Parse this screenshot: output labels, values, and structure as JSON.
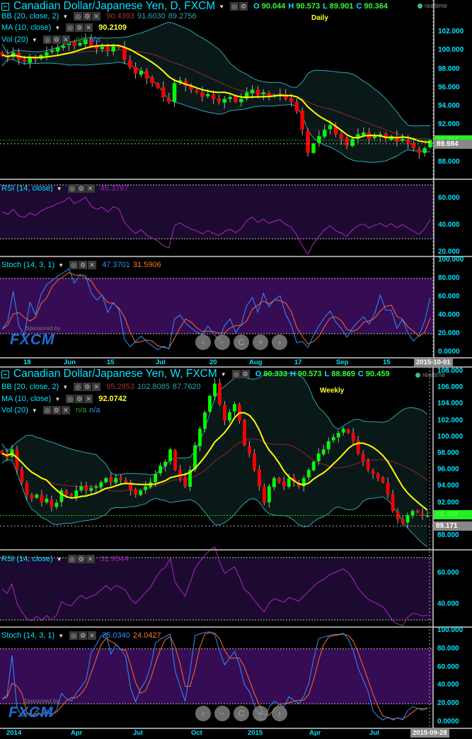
{
  "daily": {
    "title": "Canadian Dollar/Japanese Yen, D, FXCM",
    "ohlc": {
      "o_label": "O",
      "o": "90.044",
      "h_label": "H",
      "h": "90.573",
      "l_label": "L",
      "l": "89.901",
      "c_label": "C",
      "c": "90.364"
    },
    "realtime": "realtime",
    "timeframe": "Daily",
    "bb": {
      "label": "BB (20, close, 2)",
      "mid": "90.4393",
      "upper": "91.6030",
      "lower": "89.2756"
    },
    "ma": {
      "label": "MA (10, close)",
      "value": "90.2109"
    },
    "vol": {
      "label": "Vol (20)",
      "v1": "n/a",
      "v2": "n/a"
    },
    "rsi": {
      "label": "RSI (14, close)",
      "value": "45.3797"
    },
    "stoch": {
      "label": "Stoch (14, 3, 1)",
      "k": "47.3701",
      "d": "31.5906"
    },
    "price_axis": [
      "102.000",
      "100.000",
      "98.000",
      "96.000",
      "94.000",
      "92.000",
      "88.000"
    ],
    "last_price": "89.984",
    "current_price": "90.364",
    "rsi_axis": [
      "60.000",
      "40.000",
      "20.000"
    ],
    "stoch_axis": [
      "100.000",
      "80.000",
      "60.000",
      "40.000",
      "20.000",
      "0.0000"
    ],
    "x_axis": [
      "18",
      "Jun",
      "15",
      "Jul",
      "20",
      "Aug",
      "17",
      "Sep",
      "15"
    ],
    "date_badge": "2015-10-01"
  },
  "weekly": {
    "title": "Canadian Dollar/Japanese Yen, W, FXCM",
    "ohlc": {
      "o_label": "O",
      "o": "90.333",
      "h_label": "H",
      "h": "90.573",
      "l_label": "L",
      "l": "88.869",
      "c_label": "C",
      "c": "90.459"
    },
    "realtime": "realtime",
    "timeframe": "Weekly",
    "bb": {
      "label": "BB (20, close, 2)",
      "mid": "95.2853",
      "upper": "102.8085",
      "lower": "87.7620"
    },
    "ma": {
      "label": "MA (10, close)",
      "value": "92.0742"
    },
    "vol": {
      "label": "Vol (20)",
      "v1": "n/a",
      "v2": "n/a"
    },
    "rsi": {
      "label": "RSI (14, close)",
      "value": "31.9544"
    },
    "stoch": {
      "label": "Stoch (14, 3, 1)",
      "k": "25.0340",
      "d": "24.0427"
    },
    "price_axis": [
      "108.000",
      "106.000",
      "104.000",
      "102.000",
      "100.000",
      "98.000",
      "96.000",
      "94.000",
      "92.000",
      "88.000"
    ],
    "last_price": "89.171",
    "current_price": "90.459",
    "rsi_axis": [
      "60.000",
      "40.000"
    ],
    "stoch_axis": [
      "100.000",
      "80.000",
      "60.000",
      "40.000",
      "20.000",
      "0.0000"
    ],
    "x_axis": [
      "2014",
      "Apr",
      "Jul",
      "Oct",
      "2015",
      "Apr",
      "Jul"
    ],
    "date_badge": "2015-09-28"
  },
  "sponsor": {
    "text": "Sponsored by",
    "brand": "FXCM"
  },
  "nav": {
    "prev": "‹",
    "zoom_out": "−",
    "reset": "C",
    "zoom_in": "+",
    "next": "›"
  },
  "controls": {
    "visibility": "◎",
    "settings": "⚙",
    "remove": "✕",
    "dropdown": "▼"
  },
  "colors": {
    "up": "#00ff00",
    "down": "#ff0000",
    "ma": "#ffff00",
    "bb_band": "#2aa7b0",
    "bb_mid": "#8b2a2a",
    "rsi": "#b026c8",
    "stoch_k": "#2f8fff",
    "stoch_d": "#ff6a2a"
  },
  "chart_data": [
    {
      "type": "candlestick",
      "name": "CAD/JPY Daily",
      "ylim": [
        87,
        103
      ],
      "close": [
        99.5,
        99.2,
        99.8,
        99.0,
        98.8,
        99.3,
        99.0,
        99.5,
        99.8,
        100.0,
        100.3,
        100.5,
        101.0,
        100.5,
        100.8,
        101.2,
        100.5,
        100.2,
        100.4,
        100.0,
        100.5,
        100.3,
        99.0,
        98.2,
        97.5,
        97.8,
        97.0,
        96.5,
        96.0,
        95.0,
        94.5,
        96.5,
        96.8,
        96.2,
        95.8,
        95.5,
        95.0,
        95.3,
        94.8,
        94.5,
        94.8,
        95.0,
        94.5,
        94.8,
        95.5,
        95.8,
        95.2,
        95.5,
        95.0,
        95.2,
        95.3,
        94.8,
        94.5,
        93.5,
        91.5,
        89.0,
        90.0,
        90.8,
        91.5,
        92.0,
        91.0,
        90.5,
        89.8,
        90.5,
        91.0,
        91.2,
        90.5,
        90.8,
        91.0,
        90.5,
        90.8,
        90.2,
        90.5,
        90.0,
        89.5,
        89.0,
        89.5,
        90.364
      ]
    },
    {
      "type": "candlestick",
      "name": "CAD/JPY Weekly",
      "ylim": [
        87,
        108
      ],
      "close": [
        98,
        97.5,
        98.5,
        96,
        94.5,
        93,
        92.5,
        93,
        92,
        92.5,
        91.5,
        92,
        93.5,
        93,
        92.8,
        93.5,
        94,
        93.5,
        93.8,
        94,
        94.5,
        95,
        94.5,
        95,
        94.8,
        94.5,
        93.5,
        93,
        93.5,
        94,
        94.5,
        95.5,
        96.5,
        97,
        98.5,
        96,
        95,
        94,
        96,
        99,
        101,
        103,
        105,
        106.5,
        104,
        102,
        103,
        104,
        102,
        99,
        98,
        96,
        94,
        92,
        94,
        95,
        94.5,
        94,
        95,
        94.5,
        94,
        95,
        96,
        97,
        98,
        98.5,
        99.5,
        100,
        100.5,
        101,
        100.5,
        99.5,
        98,
        97,
        96,
        95.5,
        95,
        94.5,
        93,
        91,
        90,
        89.5,
        90.5,
        91,
        90.8,
        90.4,
        90.459
      ]
    }
  ]
}
